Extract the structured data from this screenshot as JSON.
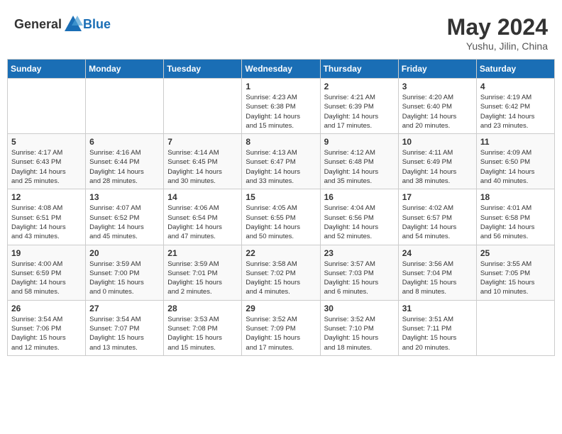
{
  "header": {
    "logo_general": "General",
    "logo_blue": "Blue",
    "month": "May 2024",
    "location": "Yushu, Jilin, China"
  },
  "weekdays": [
    "Sunday",
    "Monday",
    "Tuesday",
    "Wednesday",
    "Thursday",
    "Friday",
    "Saturday"
  ],
  "weeks": [
    [
      {
        "day": "",
        "info": ""
      },
      {
        "day": "",
        "info": ""
      },
      {
        "day": "",
        "info": ""
      },
      {
        "day": "1",
        "info": "Sunrise: 4:23 AM\nSunset: 6:38 PM\nDaylight: 14 hours\nand 15 minutes."
      },
      {
        "day": "2",
        "info": "Sunrise: 4:21 AM\nSunset: 6:39 PM\nDaylight: 14 hours\nand 17 minutes."
      },
      {
        "day": "3",
        "info": "Sunrise: 4:20 AM\nSunset: 6:40 PM\nDaylight: 14 hours\nand 20 minutes."
      },
      {
        "day": "4",
        "info": "Sunrise: 4:19 AM\nSunset: 6:42 PM\nDaylight: 14 hours\nand 23 minutes."
      }
    ],
    [
      {
        "day": "5",
        "info": "Sunrise: 4:17 AM\nSunset: 6:43 PM\nDaylight: 14 hours\nand 25 minutes."
      },
      {
        "day": "6",
        "info": "Sunrise: 4:16 AM\nSunset: 6:44 PM\nDaylight: 14 hours\nand 28 minutes."
      },
      {
        "day": "7",
        "info": "Sunrise: 4:14 AM\nSunset: 6:45 PM\nDaylight: 14 hours\nand 30 minutes."
      },
      {
        "day": "8",
        "info": "Sunrise: 4:13 AM\nSunset: 6:47 PM\nDaylight: 14 hours\nand 33 minutes."
      },
      {
        "day": "9",
        "info": "Sunrise: 4:12 AM\nSunset: 6:48 PM\nDaylight: 14 hours\nand 35 minutes."
      },
      {
        "day": "10",
        "info": "Sunrise: 4:11 AM\nSunset: 6:49 PM\nDaylight: 14 hours\nand 38 minutes."
      },
      {
        "day": "11",
        "info": "Sunrise: 4:09 AM\nSunset: 6:50 PM\nDaylight: 14 hours\nand 40 minutes."
      }
    ],
    [
      {
        "day": "12",
        "info": "Sunrise: 4:08 AM\nSunset: 6:51 PM\nDaylight: 14 hours\nand 43 minutes."
      },
      {
        "day": "13",
        "info": "Sunrise: 4:07 AM\nSunset: 6:52 PM\nDaylight: 14 hours\nand 45 minutes."
      },
      {
        "day": "14",
        "info": "Sunrise: 4:06 AM\nSunset: 6:54 PM\nDaylight: 14 hours\nand 47 minutes."
      },
      {
        "day": "15",
        "info": "Sunrise: 4:05 AM\nSunset: 6:55 PM\nDaylight: 14 hours\nand 50 minutes."
      },
      {
        "day": "16",
        "info": "Sunrise: 4:04 AM\nSunset: 6:56 PM\nDaylight: 14 hours\nand 52 minutes."
      },
      {
        "day": "17",
        "info": "Sunrise: 4:02 AM\nSunset: 6:57 PM\nDaylight: 14 hours\nand 54 minutes."
      },
      {
        "day": "18",
        "info": "Sunrise: 4:01 AM\nSunset: 6:58 PM\nDaylight: 14 hours\nand 56 minutes."
      }
    ],
    [
      {
        "day": "19",
        "info": "Sunrise: 4:00 AM\nSunset: 6:59 PM\nDaylight: 14 hours\nand 58 minutes."
      },
      {
        "day": "20",
        "info": "Sunrise: 3:59 AM\nSunset: 7:00 PM\nDaylight: 15 hours\nand 0 minutes."
      },
      {
        "day": "21",
        "info": "Sunrise: 3:59 AM\nSunset: 7:01 PM\nDaylight: 15 hours\nand 2 minutes."
      },
      {
        "day": "22",
        "info": "Sunrise: 3:58 AM\nSunset: 7:02 PM\nDaylight: 15 hours\nand 4 minutes."
      },
      {
        "day": "23",
        "info": "Sunrise: 3:57 AM\nSunset: 7:03 PM\nDaylight: 15 hours\nand 6 minutes."
      },
      {
        "day": "24",
        "info": "Sunrise: 3:56 AM\nSunset: 7:04 PM\nDaylight: 15 hours\nand 8 minutes."
      },
      {
        "day": "25",
        "info": "Sunrise: 3:55 AM\nSunset: 7:05 PM\nDaylight: 15 hours\nand 10 minutes."
      }
    ],
    [
      {
        "day": "26",
        "info": "Sunrise: 3:54 AM\nSunset: 7:06 PM\nDaylight: 15 hours\nand 12 minutes."
      },
      {
        "day": "27",
        "info": "Sunrise: 3:54 AM\nSunset: 7:07 PM\nDaylight: 15 hours\nand 13 minutes."
      },
      {
        "day": "28",
        "info": "Sunrise: 3:53 AM\nSunset: 7:08 PM\nDaylight: 15 hours\nand 15 minutes."
      },
      {
        "day": "29",
        "info": "Sunrise: 3:52 AM\nSunset: 7:09 PM\nDaylight: 15 hours\nand 17 minutes."
      },
      {
        "day": "30",
        "info": "Sunrise: 3:52 AM\nSunset: 7:10 PM\nDaylight: 15 hours\nand 18 minutes."
      },
      {
        "day": "31",
        "info": "Sunrise: 3:51 AM\nSunset: 7:11 PM\nDaylight: 15 hours\nand 20 minutes."
      },
      {
        "day": "",
        "info": ""
      }
    ]
  ]
}
